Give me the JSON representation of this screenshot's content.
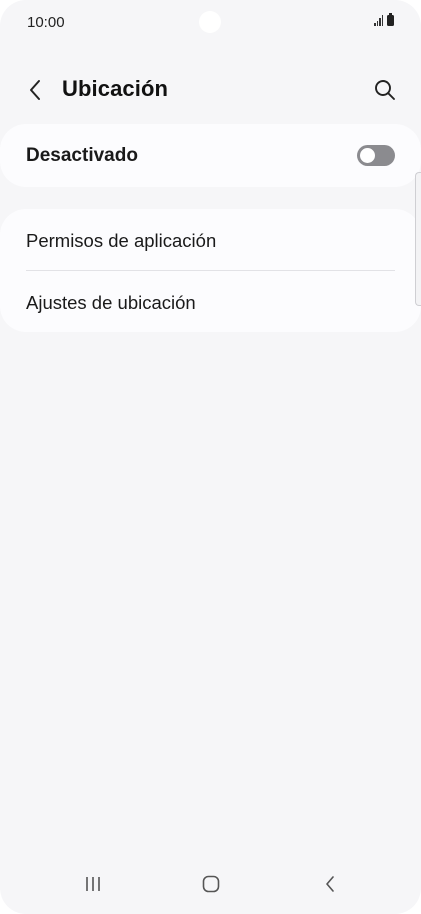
{
  "status_bar": {
    "time": "10:00",
    "signal_icon": "signal-icon",
    "battery_icon": "battery-icon"
  },
  "header": {
    "title": "Ubicación",
    "back_icon": "chevron-left-icon",
    "search_icon": "search-icon"
  },
  "location_toggle": {
    "label": "Desactivado",
    "enabled": false
  },
  "settings_list": {
    "items": [
      {
        "label": "Permisos de aplicación"
      },
      {
        "label": "Ajustes de ubicación"
      }
    ]
  },
  "nav_bar": {
    "recents_icon": "recents-icon",
    "home_icon": "home-icon",
    "back_icon": "back-icon"
  },
  "colors": {
    "background": "#f6f6f8",
    "card": "#fcfcfe",
    "toggle_off": "#8b8b8f",
    "text": "#1a1a1a"
  }
}
